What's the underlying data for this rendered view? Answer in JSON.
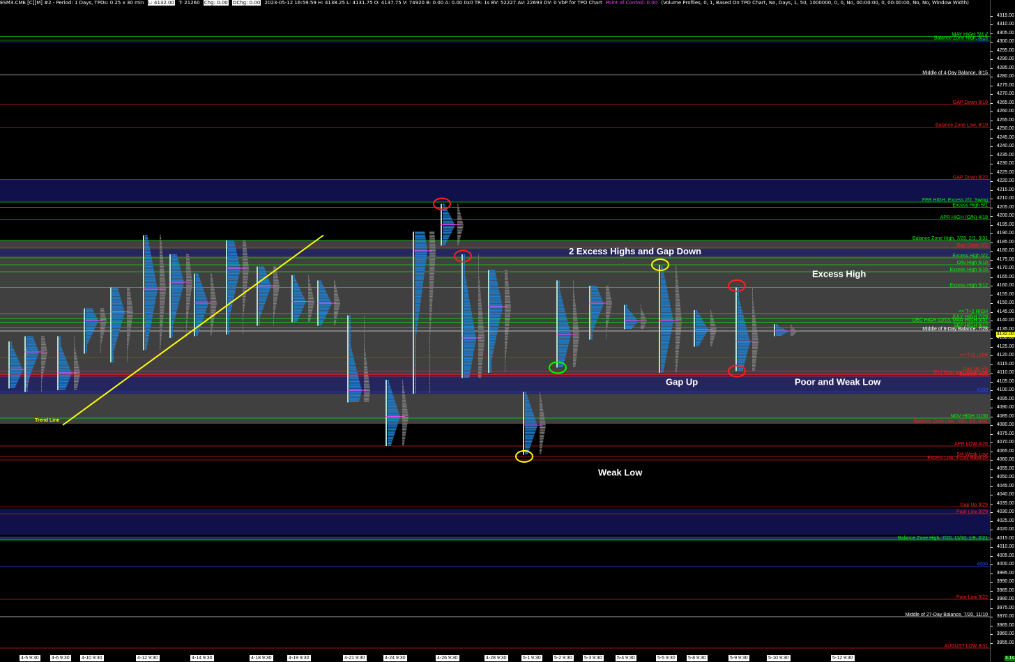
{
  "header": {
    "symbol": "ESM3.CME [C][M]  #2 - Period: 1 Days, TPOs: 0.25 x 30 min",
    "last": "L: 4132.00",
    "ticks": "T: 21260",
    "chg1": "Chg: 0.00",
    "chg2": "DChg: 0.00",
    "stats": "2023-05-12 16:59:59 H: 4138.25 L: 4131.75 O: 4137.75 V: 74920 B: 0.00 A: 0.00 0x0 TR: 1s BV: 52227 AV: 22693 DV: 0 VbP for TPO Chart",
    "poc": "Point of Control: 0.00",
    "study": "(Volume Profiles, 0, 1, Based On TPO Chart, No, Days, 1, 50, 1000000, 0, 0, No, 00:00:00, 0, 00:00:00, No, No, Window Width)"
  },
  "price_axis": {
    "current": "4132.00",
    "corner_badge": "3.1s"
  },
  "chart_data": {
    "type": "tpo-profile",
    "symbol": "ESM3.CME",
    "ylim": [
      3950,
      4320
    ],
    "y_ticks": [
      "4315.00",
      "4310.00",
      "4305.00",
      "4300.00",
      "4295.00",
      "4290.00",
      "4285.00",
      "4280.00",
      "4275.00",
      "4270.00",
      "4265.00",
      "4260.00",
      "4255.00",
      "4250.00",
      "4245.00",
      "4240.00",
      "4235.00",
      "4230.00",
      "4225.00",
      "4220.00",
      "4215.00",
      "4210.00",
      "4205.00",
      "4200.00",
      "4195.00",
      "4190.00",
      "4185.00",
      "4180.00",
      "4175.00",
      "4170.00",
      "4165.00",
      "4160.00",
      "4155.00",
      "4150.00",
      "4145.00",
      "4140.00",
      "4135.00",
      "4130.00",
      "4125.00",
      "4120.00",
      "4115.00",
      "4110.00",
      "4105.00",
      "4100.00",
      "4095.00",
      "4090.00",
      "4085.00",
      "4080.00",
      "4075.00",
      "4070.00",
      "4065.00",
      "4060.00",
      "4055.00",
      "4050.00",
      "4045.00",
      "4040.00",
      "4035.00",
      "4030.00",
      "4025.00",
      "4020.00",
      "4015.00",
      "4010.00",
      "4005.00",
      "4000.00",
      "3995.00",
      "3990.00",
      "3985.00",
      "3980.00",
      "3975.00",
      "3970.00",
      "3965.00",
      "3960.00",
      "3955.00"
    ],
    "dates": [
      "4-5  9:30",
      "4-6  9:30",
      "4-10  9:30",
      "4-12  9:30",
      "4-14  9:30",
      "4-18  9:30",
      "4-19  9:30",
      "4-21  9:30",
      "4-24  9:30",
      "4-26  9:30",
      "4-28  9:30",
      "5-1  9:30",
      "5-2  9:30",
      "5-3  9:30",
      "5-4  9:30",
      "5-5  9:30",
      "5-8  9:30",
      "5-9  9:30",
      "5-10  9:30",
      "5-12  9:30"
    ],
    "sessions": [
      {
        "low": 4101,
        "high": 4128,
        "poc": 4112
      },
      {
        "low": 4099,
        "high": 4131,
        "poc": 4122
      },
      {
        "low": 4100,
        "high": 4131,
        "poc": 4110
      },
      {
        "low": 4121,
        "high": 4147,
        "poc": 4140
      },
      {
        "low": 4116,
        "high": 4159,
        "poc": 4145
      },
      {
        "low": 4123,
        "high": 4189,
        "poc": 4158
      },
      {
        "low": 4130,
        "high": 4178,
        "poc": 4162
      },
      {
        "low": 4131,
        "high": 4167,
        "poc": 4150
      },
      {
        "low": 4132,
        "high": 4186,
        "poc": 4170
      },
      {
        "low": 4137,
        "high": 4171,
        "poc": 4160
      },
      {
        "low": 4139,
        "high": 4166,
        "poc": 4151
      },
      {
        "low": 4137,
        "high": 4163,
        "poc": 4150
      },
      {
        "low": 4093,
        "high": 4143,
        "poc": 4100
      },
      {
        "low": 4068,
        "high": 4106,
        "poc": 4085
      },
      {
        "low": 4098,
        "high": 4191,
        "poc": 4180
      },
      {
        "low": 4183,
        "high": 4207,
        "poc": 4195
      },
      {
        "low": 4107,
        "high": 4178,
        "poc": 4130
      },
      {
        "low": 4110,
        "high": 4169,
        "poc": 4148
      },
      {
        "low": 4063,
        "high": 4099,
        "poc": 4080
      },
      {
        "low": 4113,
        "high": 4163,
        "poc": 4132
      },
      {
        "low": 4129,
        "high": 4160,
        "poc": 4150
      },
      {
        "low": 4135,
        "high": 4149,
        "poc": 4140
      },
      {
        "low": 4110,
        "high": 4172,
        "poc": 4140
      },
      {
        "low": 4125,
        "high": 4146,
        "poc": 4135
      },
      {
        "low": 4111,
        "high": 4159,
        "poc": 4128
      },
      {
        "low": 4131,
        "high": 4138,
        "poc": 4134
      }
    ],
    "levels": [
      {
        "price": 4303,
        "label": "MAY HIGH 5/4 //",
        "color": "#00ff00"
      },
      {
        "price": 4301,
        "label": "Balance Zone High, 8/15",
        "color": "#00ff00"
      },
      {
        "price": 4300,
        "label": "4300",
        "color": "#2050ff"
      },
      {
        "price": 4281,
        "label": "Middle of 4-Day Balance, 8/15",
        "color": "#ffffff"
      },
      {
        "price": 4264,
        "label": "GAP Down 8/19",
        "color": "#ff2020"
      },
      {
        "price": 4251,
        "label": "Balance Zone Low, 8/19",
        "color": "#ff2020"
      },
      {
        "price": 4221,
        "label": "GAP Down 8/22",
        "color": "#ff2020"
      },
      {
        "price": 4208,
        "label": "FEB HIGH, Excess 2/2, Swing",
        "color": "#00ff00"
      },
      {
        "price": 4205,
        "label": "Excess High 5/1",
        "color": "#00ff00"
      },
      {
        "price": 4198,
        "label": "APR HIGH (O/N) 4/18",
        "color": "#00ff00"
      },
      {
        "price": 4186,
        "label": "Balance Zone High, 7/28, 2/1, 3/31",
        "color": "#00ff00"
      },
      {
        "price": 4182,
        "label": "Gap Down 5/2",
        "color": "#ff2020"
      },
      {
        "price": 4176,
        "label": "Excess High 5/2",
        "color": "#00ff00"
      },
      {
        "price": 4172,
        "label": "O/N High 5/10",
        "color": "#00ff00"
      },
      {
        "price": 4168,
        "label": "Excess High 5/10",
        "color": "#00ff00"
      },
      {
        "price": 4159,
        "label": "Excess High 5/12",
        "color": "#00ff00"
      },
      {
        "price": 4144,
        "label": "<< T+2 HIGH",
        "color": "#00ff00"
      },
      {
        "price": 4141,
        "label": "JULY HIGH 7/29",
        "color": "#00ff00"
      },
      {
        "price": 4139,
        "label": "DEC HIGH 12/13, MAR HIGH 3/31",
        "color": "#00ff00"
      },
      {
        "price": 4136,
        "label": "SEP HIGH 9/12",
        "color": "#00ff00"
      },
      {
        "price": 4134,
        "label": "Middle of 8-Day Balance, 7/28",
        "color": "#ffffff"
      },
      {
        "price": 4119,
        "label": "<< T+2 LOW",
        "color": "#ff2020"
      },
      {
        "price": 4111,
        "label": "Gap Up 5/5",
        "color": "#ff2020"
      },
      {
        "price": 4109,
        "label": "5/12 Poor and Weak Low",
        "color": "#ff2020"
      },
      {
        "price": 4108,
        "label": "Balance 4/25",
        "color": "#ff2020"
      },
      {
        "price": 4099,
        "label": "4100",
        "color": "#2050ff"
      },
      {
        "price": 4084,
        "label": "NOV HIGH 11/30",
        "color": "#00ff00"
      },
      {
        "price": 4081,
        "label": "Balance Zone Low, 7/20, 2/1, 3/31",
        "color": "#ff2020"
      },
      {
        "price": 4068,
        "label": "APR LOW 4/26",
        "color": "#ff2020"
      },
      {
        "price": 4062,
        "label": "5/4 Weak Low",
        "color": "#ff2020"
      },
      {
        "price": 4060,
        "label": "Excess Low, 4-Day Balance",
        "color": "#ff2020"
      },
      {
        "price": 4033,
        "label": "Gap Up 3/29",
        "color": "#ff2020"
      },
      {
        "price": 4029,
        "label": "Poor Low 3/29",
        "color": "#ff2020"
      },
      {
        "price": 4014,
        "label": "Balance Zone High, 7/20, 11/10, 1/9, 2/21",
        "color": "#00ff00"
      },
      {
        "price": 3999,
        "label": "4000",
        "color": "#2050ff"
      },
      {
        "price": 3980,
        "label": "Poor Low 3/22",
        "color": "#ff2020"
      },
      {
        "price": 3970,
        "label": "Middle of 27-Day Balance, 7/20, 11/10",
        "color": "#ffffff"
      },
      {
        "price": 3952,
        "label": "AUGUST LOW 8/31",
        "color": "#ff2020"
      }
    ],
    "zones": [
      {
        "from": 4208,
        "to": 4221,
        "color": "#10104a"
      },
      {
        "from": 4017,
        "to": 4032,
        "color": "#10104a"
      },
      {
        "from": 4014,
        "to": 4016,
        "color": "#1c2f6a"
      },
      {
        "from": 4098,
        "to": 4109,
        "color": "#26265e"
      },
      {
        "from": 4177,
        "to": 4181,
        "color": "#26265e"
      }
    ],
    "annotations": [
      {
        "text": "2 Excess Highs and Gap Down",
        "price": 4178
      },
      {
        "text": "Excess High",
        "price": 4165
      },
      {
        "text": "Gap Up",
        "price": 4103
      },
      {
        "text": "Poor and Weak Low",
        "price": 4103
      },
      {
        "text": "Weak Low",
        "price": 4051
      },
      {
        "text": "Trend Line",
        "price": 4082
      }
    ],
    "markers": [
      {
        "session": 15,
        "price": 4207,
        "color": "#ff2020"
      },
      {
        "session": 16,
        "price": 4177,
        "color": "#ff2020"
      },
      {
        "session": 18,
        "price": 4062,
        "color": "#ffff00"
      },
      {
        "session": 19,
        "price": 4113,
        "color": "#00ff00"
      },
      {
        "session": 22,
        "price": 4172,
        "color": "#ffff00"
      },
      {
        "session": 24,
        "price": 4160,
        "color": "#ff2020"
      },
      {
        "session": 24,
        "price": 4111,
        "color": "#ff2020"
      }
    ],
    "trendline": {
      "from": {
        "session": 1,
        "price": 4080
      },
      "to": {
        "session": 8,
        "price": 4189
      },
      "color": "#ffff00"
    }
  }
}
